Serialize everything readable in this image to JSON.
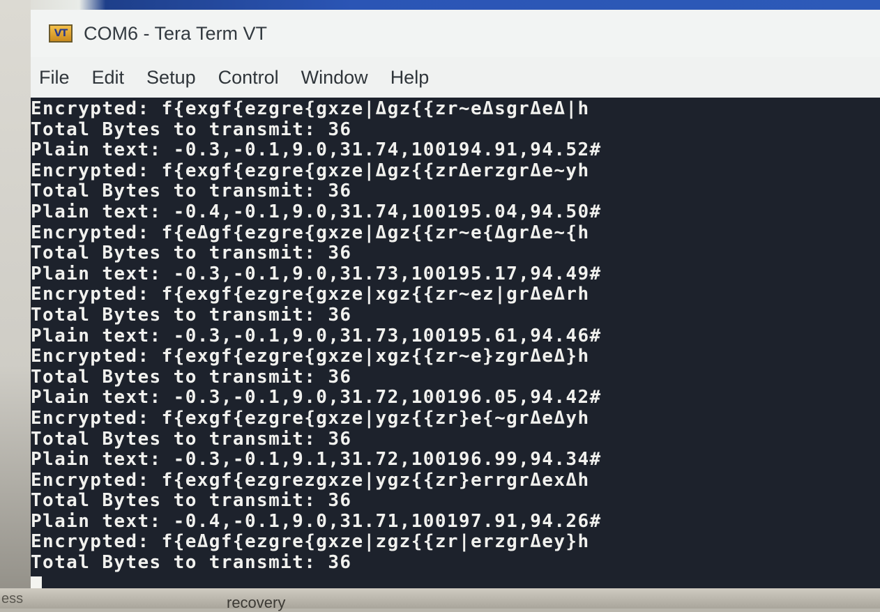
{
  "window": {
    "title": "COM6 - Tera Term VT",
    "icon_label": "VT"
  },
  "menu": [
    "File",
    "Edit",
    "Setup",
    "Control",
    "Window",
    "Help"
  ],
  "terminal": {
    "lines": [
      "Encrypted: f{exgf{ezgre{gxze|Δgz{{zr~eΔsgrΔeΔ|h",
      "Total Bytes to transmit: 36",
      "Plain text: -0.3,-0.1,9.0,31.74,100194.91,94.52#",
      "Encrypted: f{exgf{ezgre{gxze|Δgz{{zrΔerzgrΔe~yh",
      "Total Bytes to transmit: 36",
      "Plain text: -0.4,-0.1,9.0,31.74,100195.04,94.50#",
      "Encrypted: f{eΔgf{ezgre{gxze|Δgz{{zr~e{ΔgrΔe~{h",
      "Total Bytes to transmit: 36",
      "Plain text: -0.3,-0.1,9.0,31.73,100195.17,94.49#",
      "Encrypted: f{exgf{ezgre{gxze|xgz{{zr~ez|grΔeΔrh",
      "Total Bytes to transmit: 36",
      "Plain text: -0.3,-0.1,9.0,31.73,100195.61,94.46#",
      "Encrypted: f{exgf{ezgre{gxze|xgz{{zr~e}zgrΔeΔ}h",
      "Total Bytes to transmit: 36",
      "Plain text: -0.3,-0.1,9.0,31.72,100196.05,94.42#",
      "Encrypted: f{exgf{ezgre{gxze|ygz{{zr}e{~grΔeΔyh",
      "Total Bytes to transmit: 36",
      "Plain text: -0.3,-0.1,9.1,31.72,100196.99,94.34#",
      "Encrypted: f{exgf{ezgrezgxze|ygz{{zr}errgrΔexΔh",
      "Total Bytes to transmit: 36",
      "Plain text: -0.4,-0.1,9.0,31.71,100197.91,94.26#",
      "Encrypted: f{eΔgf{ezgre{gxze|zgz{{zr|erzgrΔey}h",
      "Total Bytes to transmit: 36"
    ]
  },
  "background": {
    "left_fragment": "ess",
    "mid_fragment": "recovery"
  }
}
